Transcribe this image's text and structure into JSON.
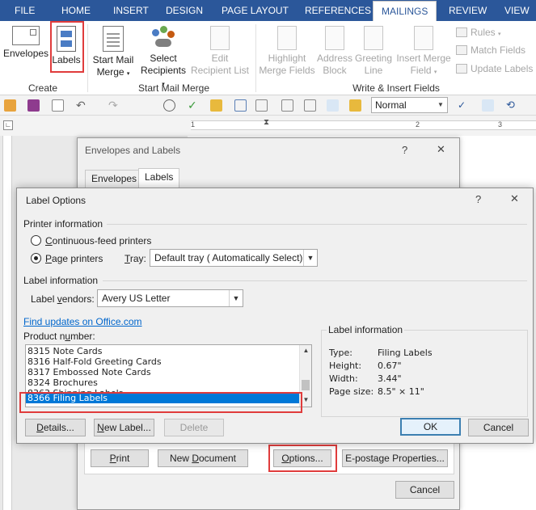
{
  "ribbon": {
    "tabs": [
      "FILE",
      "HOME",
      "INSERT",
      "DESIGN",
      "PAGE LAYOUT",
      "REFERENCES",
      "MAILINGS",
      "REVIEW",
      "VIEW"
    ],
    "active_tab": "MAILINGS",
    "create": {
      "group_label": "Create",
      "envelopes": "Envelopes",
      "labels": "Labels"
    },
    "start_mail_merge": {
      "group_label": "Start Mail Merge",
      "start_line1": "Start Mail",
      "start_line2": "Merge",
      "select_line1": "Select",
      "select_line2": "Recipients",
      "edit_line1": "Edit",
      "edit_line2": "Recipient List"
    },
    "write_insert": {
      "group_label": "Write & Insert Fields",
      "highlight_line1": "Highlight",
      "highlight_line2": "Merge Fields",
      "address_line1": "Address",
      "address_line2": "Block",
      "greeting_line1": "Greeting",
      "greeting_line2": "Line",
      "insert_line1": "Insert Merge",
      "insert_line2": "Field",
      "rules": "Rules",
      "match_fields": "Match Fields",
      "update_labels": "Update Labels"
    }
  },
  "qat": {
    "style": "Normal"
  },
  "ruler": {
    "numbers": [
      "1",
      "2",
      "3"
    ]
  },
  "envelopes_dialog": {
    "title": "Envelopes and Labels",
    "help": "?",
    "close": "✕",
    "tabs": [
      "Envelopes",
      "Labels"
    ],
    "buttons": {
      "print": "Print",
      "new_document": "New Document",
      "options": "Options...",
      "epostage": "E-postage Properties...",
      "cancel": "Cancel"
    }
  },
  "label_options": {
    "title": "Label Options",
    "help": "?",
    "close": "✕",
    "printer_info": "Printer information",
    "continuous": "Continuous-feed printers",
    "page": "Page printers",
    "tray_label": "Tray:",
    "tray_value": "Default tray ( Automatically Select)",
    "label_info_section": "Label information",
    "vendors_label": "Label vendors:",
    "vendors_value": "Avery US Letter",
    "find_updates": "Find updates on Office.com",
    "product_number": "Product number:",
    "products": [
      "8315 Note Cards",
      "8316 Half-Fold Greeting Cards",
      "8317 Embossed Note Cards",
      "8324 Brochures",
      "8363 Shipping Labels",
      "8366 Filing Labels"
    ],
    "selected_product": "8366 Filing Labels",
    "info_box": {
      "heading": "Label information",
      "type_k": "Type:",
      "type_v": "Filing Labels",
      "height_k": "Height:",
      "height_v": "0.67\"",
      "width_k": "Width:",
      "width_v": "3.44\"",
      "page_k": "Page size:",
      "page_v": "8.5\" × 11\""
    },
    "buttons": {
      "details": "Details...",
      "new_label": "New Label...",
      "delete": "Delete",
      "ok": "OK",
      "cancel": "Cancel"
    }
  },
  "colors": {
    "ribbon_blue": "#2b579a",
    "selection_blue": "#0078d7",
    "highlight_red": "#e03c3c",
    "link_blue": "#0066cc"
  }
}
